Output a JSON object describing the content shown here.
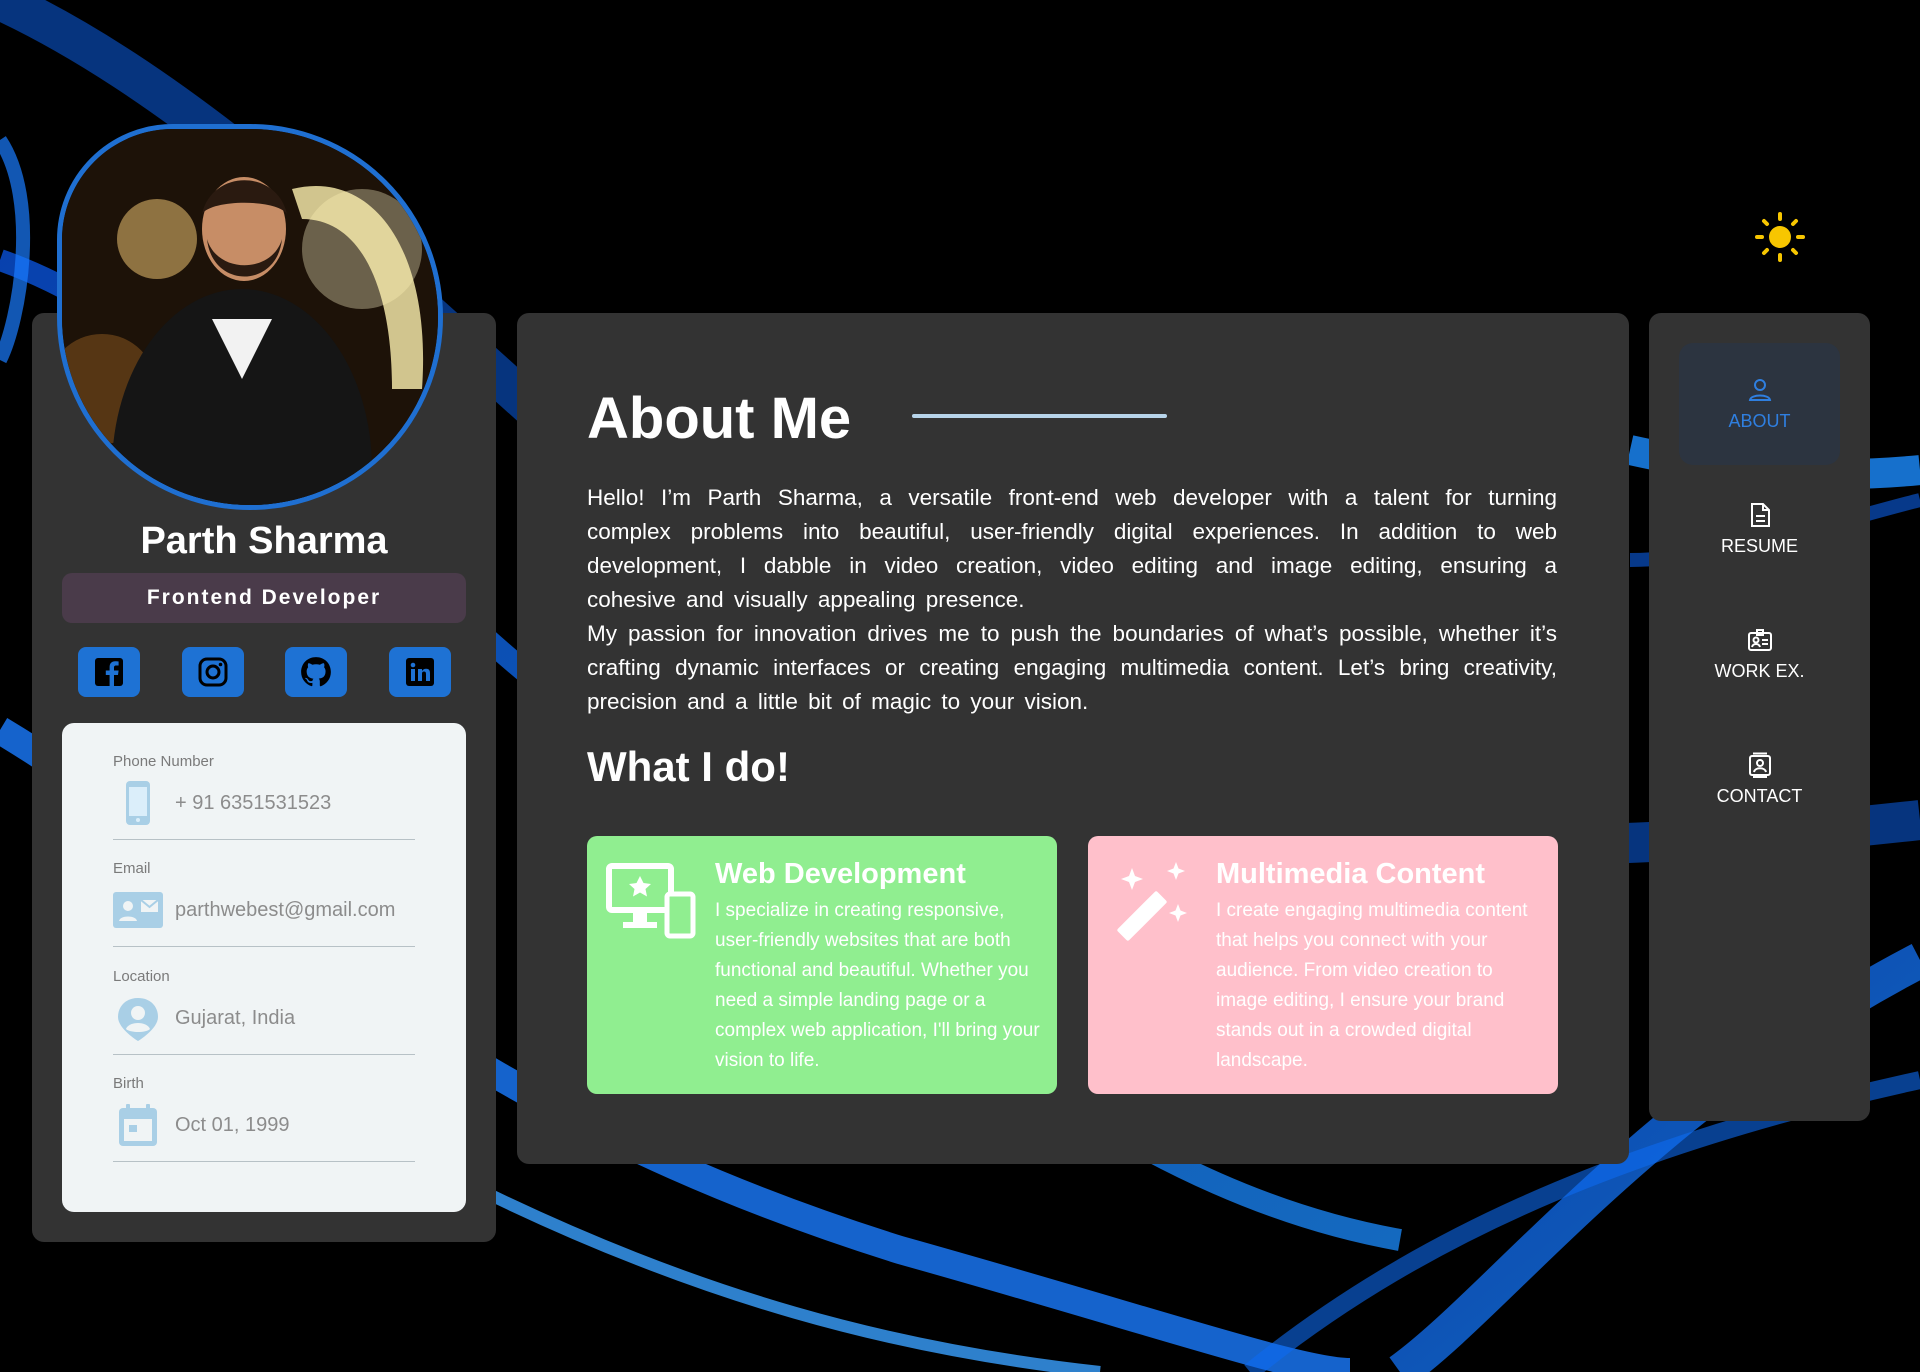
{
  "profile": {
    "name": "Parth Sharma",
    "title": "Frontend Developer",
    "social": [
      "facebook-icon",
      "instagram-icon",
      "github-icon",
      "linkedin-icon"
    ],
    "contacts": [
      {
        "label": "Phone Number",
        "value": "+ 91 6351531523",
        "icon": "phone-icon"
      },
      {
        "label": "Email",
        "value": "parthwebest@gmail.com",
        "icon": "email-card-icon"
      },
      {
        "label": "Location",
        "value": "Gujarat, India",
        "icon": "location-user-icon"
      },
      {
        "label": "Birth",
        "value": "Oct 01, 1999",
        "icon": "calendar-icon"
      }
    ]
  },
  "main": {
    "title": "About Me",
    "paragraphs": [
      "Hello! I’m Parth Sharma, a versatile front-end web developer with a talent for turning complex problems into beautiful, user-friendly digital experiences. In addition to web development, I dabble in video creation, video editing and image editing, ensuring a cohesive and visually appealing presence.",
      "My passion for innovation drives me to push the boundaries of what’s possible, whether it’s crafting dynamic interfaces or creating engaging multimedia content. Let’s bring creativity, precision and a little bit of magic to your vision."
    ],
    "services_title": "What I do!",
    "services": [
      {
        "title": "Web Development",
        "desc": "I specialize in creating responsive, user-friendly websites that are both functional and beautiful. Whether you need a simple landing page or a complex web application, I'll bring your vision to life.",
        "color": "#90ee90"
      },
      {
        "title": "Multimedia Content",
        "desc": "I create engaging multimedia content that helps you connect with your audience. From video creation to image editing, I ensure your brand stands out in a crowded digital landscape.",
        "color": "#ffc0cb"
      }
    ]
  },
  "nav": {
    "items": [
      {
        "label": "ABOUT",
        "icon": "user-icon",
        "active": true
      },
      {
        "label": "RESUME",
        "icon": "document-icon",
        "active": false
      },
      {
        "label": "WORK EX.",
        "icon": "id-badge-icon",
        "active": false
      },
      {
        "label": "CONTACT",
        "icon": "contact-card-icon",
        "active": false
      }
    ]
  },
  "colors": {
    "accent": "#1e72d4",
    "panel": "#333333",
    "sun": "#f7c600"
  }
}
